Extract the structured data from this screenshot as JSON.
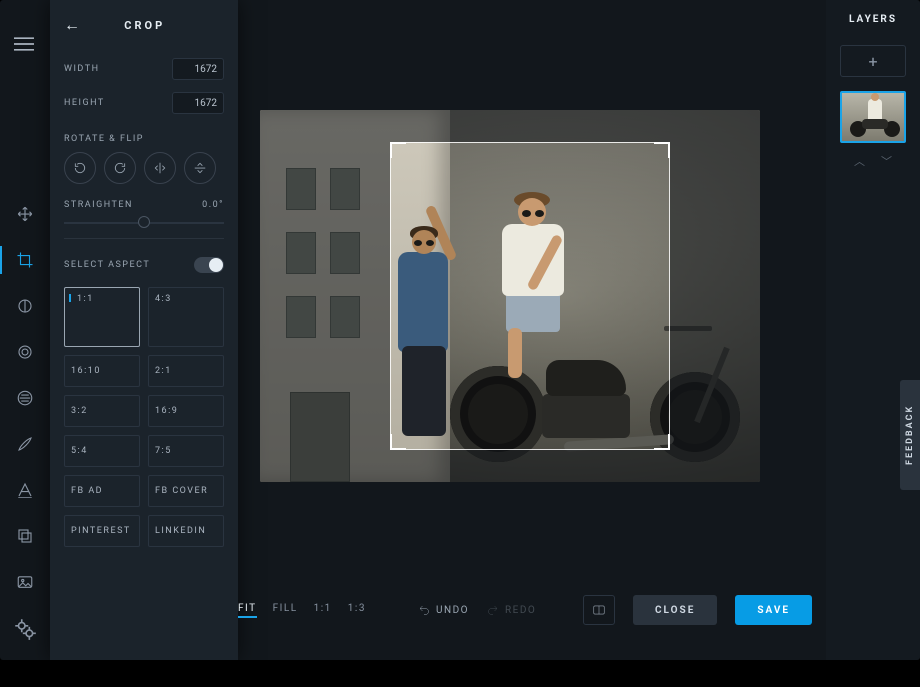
{
  "panel": {
    "title": "CROP",
    "width_label": "WIDTH",
    "width_value": "1672",
    "height_label": "HEIGHT",
    "height_value": "1672",
    "rotate_label": "ROTATE & FLIP",
    "straighten_label": "STRAIGHTEN",
    "straighten_value": "0.0°",
    "select_aspect_label": "SELECT ASPECT",
    "aspects": [
      "1:1",
      "4:3",
      "16:10",
      "2:1",
      "3:2",
      "16:9",
      "5:4",
      "7:5",
      "FB AD",
      "FB COVER",
      "PINTEREST",
      "LINKEDIN"
    ]
  },
  "zoom": {
    "options": [
      "FIT",
      "FILL",
      "1:1",
      "1:3"
    ],
    "active": "FIT"
  },
  "history": {
    "undo": "UNDO",
    "redo": "REDO"
  },
  "actions": {
    "close": "CLOSE",
    "save": "SAVE"
  },
  "layers": {
    "title": "LAYERS"
  },
  "feedback": "FEEDBACK"
}
